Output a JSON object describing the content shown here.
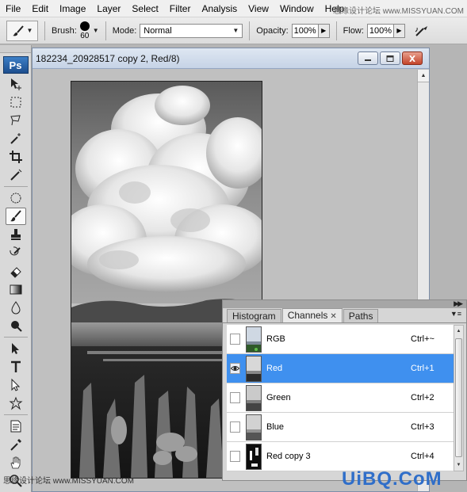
{
  "menu": {
    "items": [
      "File",
      "Edit",
      "Image",
      "Layer",
      "Select",
      "Filter",
      "Analysis",
      "View",
      "Window",
      "Help"
    ],
    "watermark": "思缘设计论坛  www.MISSYUAN.COM"
  },
  "options": {
    "brush_label": "Brush:",
    "brush_size": "60",
    "mode_label": "Mode:",
    "mode_value": "Normal",
    "opacity_label": "Opacity:",
    "opacity_value": "100%",
    "flow_label": "Flow:",
    "flow_value": "100%"
  },
  "toolbox": {
    "logo": "Ps"
  },
  "document": {
    "title": "182234_20928517 copy 2, Red/8)"
  },
  "panel": {
    "tabs": [
      "Histogram",
      "Channels",
      "Paths"
    ],
    "active_tab": "Channels",
    "channels": [
      {
        "name": "RGB",
        "shortcut": "Ctrl+~",
        "visible": false,
        "selected": false
      },
      {
        "name": "Red",
        "shortcut": "Ctrl+1",
        "visible": true,
        "selected": true
      },
      {
        "name": "Green",
        "shortcut": "Ctrl+2",
        "visible": false,
        "selected": false
      },
      {
        "name": "Blue",
        "shortcut": "Ctrl+3",
        "visible": false,
        "selected": false
      },
      {
        "name": "Red copy 3",
        "shortcut": "Ctrl+4",
        "visible": false,
        "selected": false
      }
    ]
  },
  "watermarks": {
    "bottom_left": "思缘设计论坛  www.MISSYUAN.COM",
    "bottom_right": "UiBQ.CoM"
  },
  "colors": {
    "selection": "#3f90ef",
    "ps_logo": "#2a67ad"
  }
}
